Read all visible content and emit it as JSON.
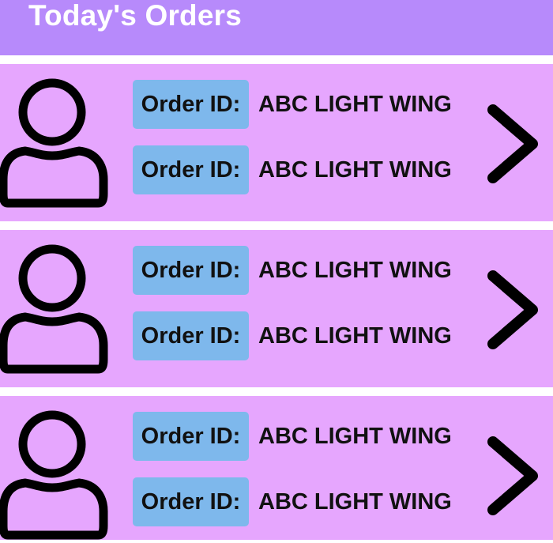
{
  "header": {
    "title": "Today's Orders"
  },
  "colors": {
    "header_bg": "#b78afb",
    "card_bg": "#e6a6fe",
    "label_bg": "#7eb8ec",
    "text": "#111111"
  },
  "icons": {
    "avatar": "person-outline-icon",
    "chevron": "chevron-right-icon"
  },
  "orders": [
    {
      "rows": [
        {
          "label": "Order ID:",
          "value": "ABC LIGHT WING"
        },
        {
          "label": "Order ID:",
          "value": "ABC LIGHT WING"
        }
      ]
    },
    {
      "rows": [
        {
          "label": "Order ID:",
          "value": "ABC LIGHT WING"
        },
        {
          "label": "Order ID:",
          "value": "ABC LIGHT WING"
        }
      ]
    },
    {
      "rows": [
        {
          "label": "Order ID:",
          "value": "ABC LIGHT WING"
        },
        {
          "label": "Order ID:",
          "value": "ABC LIGHT WING"
        }
      ]
    }
  ]
}
